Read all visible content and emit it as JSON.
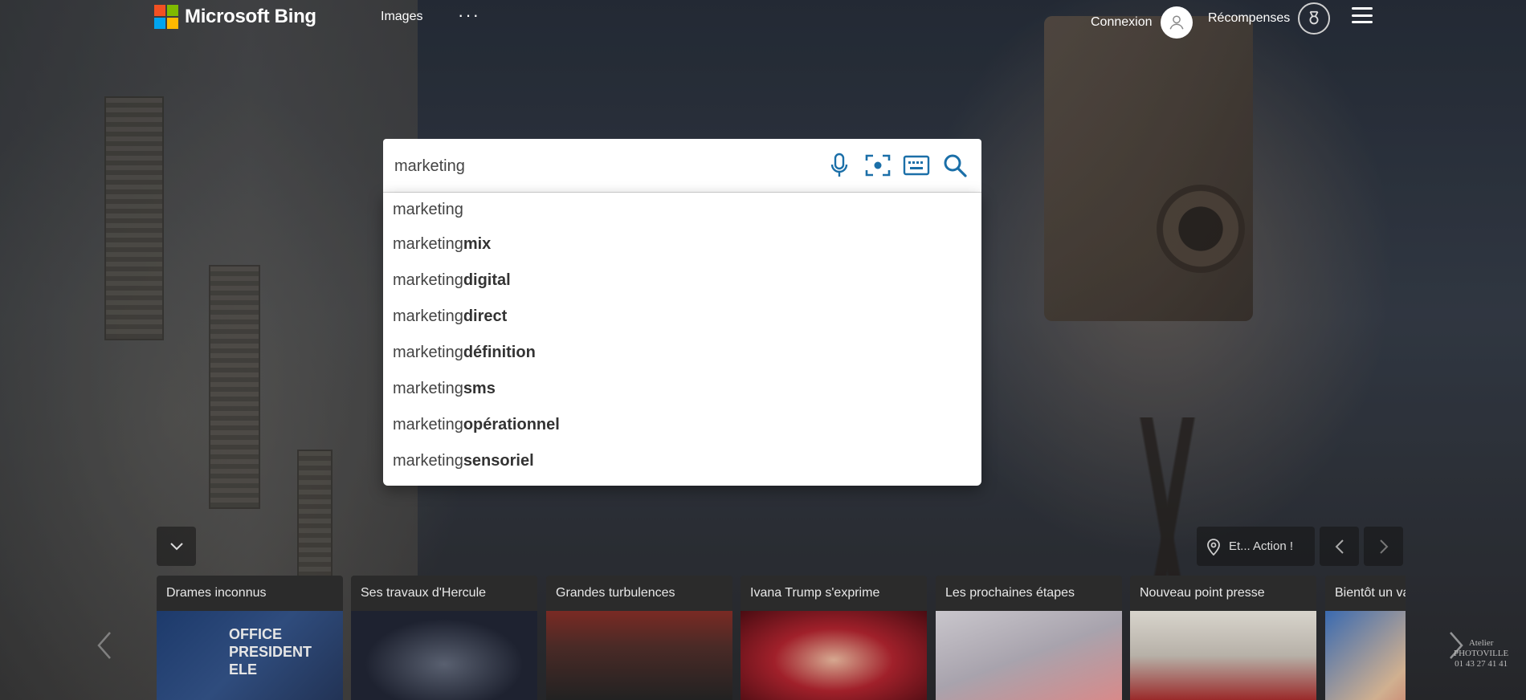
{
  "header": {
    "logo_text": "Microsoft Bing",
    "nav_images": "Images",
    "nav_more": "···",
    "signin_label": "Connexion",
    "rewards_label": "Récompenses"
  },
  "search": {
    "value": "marketing",
    "suggestions": [
      {
        "prefix": "marketing",
        "bold": ""
      },
      {
        "prefix": "marketing ",
        "bold": "mix"
      },
      {
        "prefix": "marketing ",
        "bold": "digital"
      },
      {
        "prefix": "marketing ",
        "bold": "direct"
      },
      {
        "prefix": "marketing ",
        "bold": "définition"
      },
      {
        "prefix": "marketing ",
        "bold": "sms"
      },
      {
        "prefix": "marketing ",
        "bold": "opérationnel"
      },
      {
        "prefix": "marketing ",
        "bold": "sensoriel"
      }
    ]
  },
  "bottom": {
    "location_label": "Et... Action !",
    "cards": [
      {
        "title": "Drames inconnus",
        "thumb_text": "OFFICE PRESIDENT ELE"
      },
      {
        "title": "Ses travaux d'Hercule",
        "thumb_text": ""
      },
      {
        "title": "Grandes turbulences",
        "thumb_text": ""
      },
      {
        "title": "Ivana Trump s'exprime",
        "thumb_text": ""
      },
      {
        "title": "Les prochaines étapes",
        "thumb_text": ""
      },
      {
        "title": "Nouveau point presse",
        "thumb_text": ""
      },
      {
        "title": "Bientôt un va",
        "thumb_text": ""
      }
    ],
    "watermark": "Atelier\nPHOTOVILLE\n01 43 27 41 41"
  },
  "colors": {
    "accent": "#1b6fa8",
    "logo_red": "#f25022",
    "logo_green": "#7fba00",
    "logo_blue": "#00a4ef",
    "logo_yellow": "#ffb900"
  },
  "icons": [
    "microphone-icon",
    "visual-search-icon",
    "keyboard-icon",
    "search-icon",
    "user-icon",
    "rewards-icon",
    "hamburger-icon",
    "chevron-down-icon",
    "location-pin-icon",
    "chevron-left-icon",
    "chevron-right-icon"
  ]
}
